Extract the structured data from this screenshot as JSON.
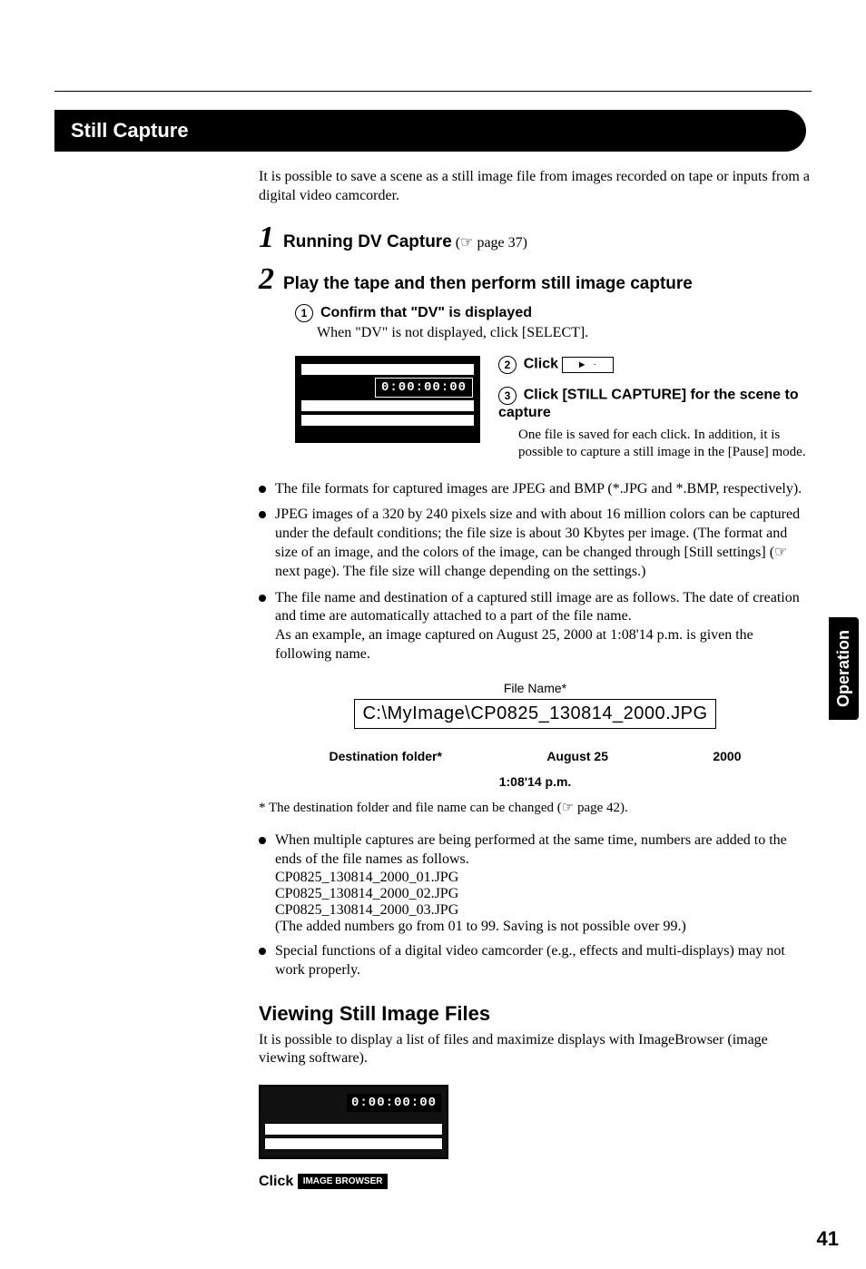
{
  "side_tab": "Operation",
  "page_number": "41",
  "section_title": "Still Capture",
  "intro": "It is possible to save a scene as a still image file from images recorded on tape or inputs from a digital video camcorder.",
  "step1_num": "1",
  "step1_text": "Running DV Capture",
  "step1_ref": "(☞ page 37)",
  "step2_num": "2",
  "step2_text": "Play the tape and then perform still image capture",
  "sub1_head": "Confirm that \"DV\" is displayed",
  "sub1_body": "When \"DV\" is not displayed, click [SELECT].",
  "timecode": "0:00:00:00",
  "sub2_head": "Click",
  "play_glyph": "► ·",
  "sub3_head": "Click [STILL CAPTURE] for the scene to capture",
  "sub3_body": "One file is saved for each click.  In addition, it is possible to capture a still image in the [Pause] mode.",
  "bullets_a": {
    "b1": "The file formats for captured images are JPEG and BMP (*.JPG and *.BMP, respectively).",
    "b2": "JPEG images of a 320 by 240 pixels size and with about 16 million colors can be captured under the default conditions; the file size is about 30 Kbytes per image. (The format and size of an image, and the colors of the image, can be changed through [Still settings] (☞ next page). The file size will change depending on the settings.)",
    "b3": "The file name and destination of a captured still image are as follows. The date of creation and time are automatically attached to a part of the file name.",
    "b3_cont": "As an example, an image captured on August 25, 2000 at 1:08'14 p.m. is given the following name."
  },
  "filename": {
    "top_label": "File Name*",
    "main": "C:\\MyImage\\CP0825_130814_2000.JPG",
    "dest_label": "Destination folder*",
    "aug_label": "August 25",
    "year_label": "2000",
    "time_label": "1:08'14 p.m."
  },
  "footnote": "* The destination folder and file name can be changed (☞ page 42).",
  "bullets_b": {
    "b1": "When multiple captures are being performed at the same time, numbers are added to the ends of the file names as follows.",
    "f1": "CP0825_130814_2000_01.JPG",
    "f2": "CP0825_130814_2000_02.JPG",
    "f3": "CP0825_130814_2000_03.JPG",
    "note": "(The added numbers go from 01 to 99. Saving is not possible over 99.)",
    "b2": "Special functions of a digital video camcorder (e.g., effects and multi-displays) may not work properly."
  },
  "h2": "Viewing Still Image Files",
  "para2": "It is possible to display a list of files and maximize displays with ImageBrowser (image viewing software).",
  "timecode2": "0:00:00:00",
  "click_text": "Click",
  "imgbrowser_btn": "IMAGE BROWSER"
}
